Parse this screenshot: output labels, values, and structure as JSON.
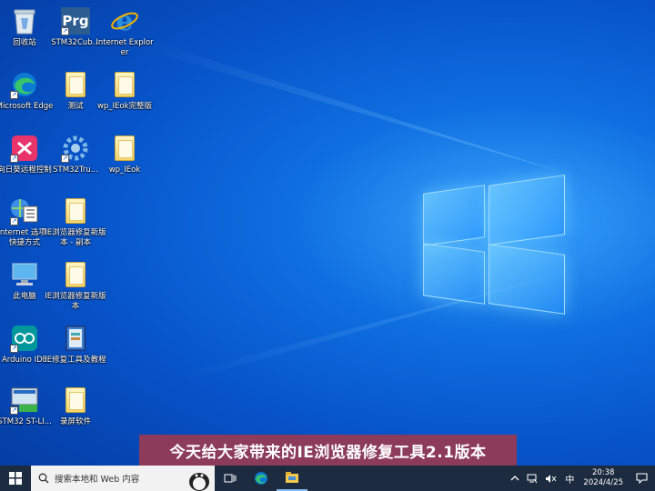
{
  "desktop": {
    "icons": [
      {
        "label": "回收站"
      },
      {
        "label": "STM32Cub..."
      },
      {
        "label": "Internet Explorer"
      },
      {
        "label": "Microsoft Edge"
      },
      {
        "label": "测试"
      },
      {
        "label": "wp_IEok完整版"
      },
      {
        "label": "向日葵远程控制"
      },
      {
        "label": "STM32Tru..."
      },
      {
        "label": "wp_IEok"
      },
      {
        "label": "Internet 选项 - 快捷方式"
      },
      {
        "label": "IE浏览器修复新版本 - 副本"
      },
      {
        "label": "此电脑"
      },
      {
        "label": "IE浏览器修复新版本"
      },
      {
        "label": "Arduino IDE"
      },
      {
        "label": "IE修复工具及教程"
      },
      {
        "label": "STM32 ST-LI..."
      },
      {
        "label": "录屏软件"
      }
    ],
    "prg_text": "Prg"
  },
  "subtitle": "今天给大家带来的IE浏览器修复工具2.1版本",
  "taskbar": {
    "search_placeholder": "搜索本地和 Web 内容",
    "ime": "中",
    "time": "20:38",
    "date": "2024/4/25"
  },
  "colors": {
    "taskbar": "#1c2b3f",
    "subtitle_bg": "#8c3c5a"
  }
}
